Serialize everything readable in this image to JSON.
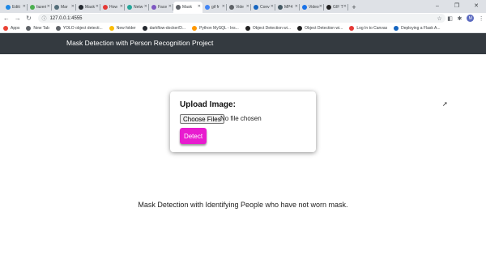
{
  "browser": {
    "tabs": [
      {
        "label": "Editi",
        "color": "#1e88e5"
      },
      {
        "label": "fazeri",
        "color": "#4caf50"
      },
      {
        "label": "Mar",
        "color": "#546e7a"
      },
      {
        "label": "Mask",
        "color": "#24292f"
      },
      {
        "label": "How",
        "color": "#e53935"
      },
      {
        "label": "Netw",
        "color": "#26a69a"
      },
      {
        "label": "Face",
        "color": "#7e57c2"
      },
      {
        "label": "Mask",
        "color": "#5f6368",
        "active": true
      },
      {
        "label": "gif fr",
        "color": "#4285f4"
      },
      {
        "label": "Vide",
        "color": "#5f6368"
      },
      {
        "label": "Conv",
        "color": "#1565c0"
      },
      {
        "label": "MP4",
        "color": "#455a64"
      },
      {
        "label": "Video",
        "color": "#1a73e8"
      },
      {
        "label": "GIF T",
        "color": "#212121"
      }
    ],
    "new_tab_glyph": "+",
    "window_controls": {
      "minimize": "–",
      "maximize": "❐",
      "close": "✕"
    },
    "back_glyph": "←",
    "forward_glyph": "→",
    "reload_glyph": "↻",
    "url": "127.0.0.1:4555",
    "bookmarks": [
      {
        "label": "Apps",
        "color": "#ea4335"
      },
      {
        "label": "New Tab",
        "color": "#5f6368"
      },
      {
        "label": "YOLO object detecti...",
        "color": "#5f6368"
      },
      {
        "label": "New folder",
        "color": "#fbbc04"
      },
      {
        "label": "darkflow-docker/D...",
        "color": "#24292f"
      },
      {
        "label": "Python MySQL - Ins...",
        "color": "#ff9800"
      },
      {
        "label": "Object Detection wi...",
        "color": "#212121"
      },
      {
        "label": "Object Detection wi...",
        "color": "#212121"
      },
      {
        "label": "Log In to Canvas",
        "color": "#e53935"
      },
      {
        "label": "Deploying a Flask A...",
        "color": "#1565c0"
      }
    ],
    "profile_initial": "M"
  },
  "navbar": {
    "brand": "Mask Detection with Person Recognition Project"
  },
  "upload": {
    "title": "Upload Image:",
    "choose_label": "Choose Files",
    "no_file_text": "No file chosen",
    "detect_label": "Detect"
  },
  "caption": "Mask Detection with Identifying People who have not worn mask.",
  "colors": {
    "navbar_bg": "#343a40",
    "detect_button": "#e81ccf"
  }
}
